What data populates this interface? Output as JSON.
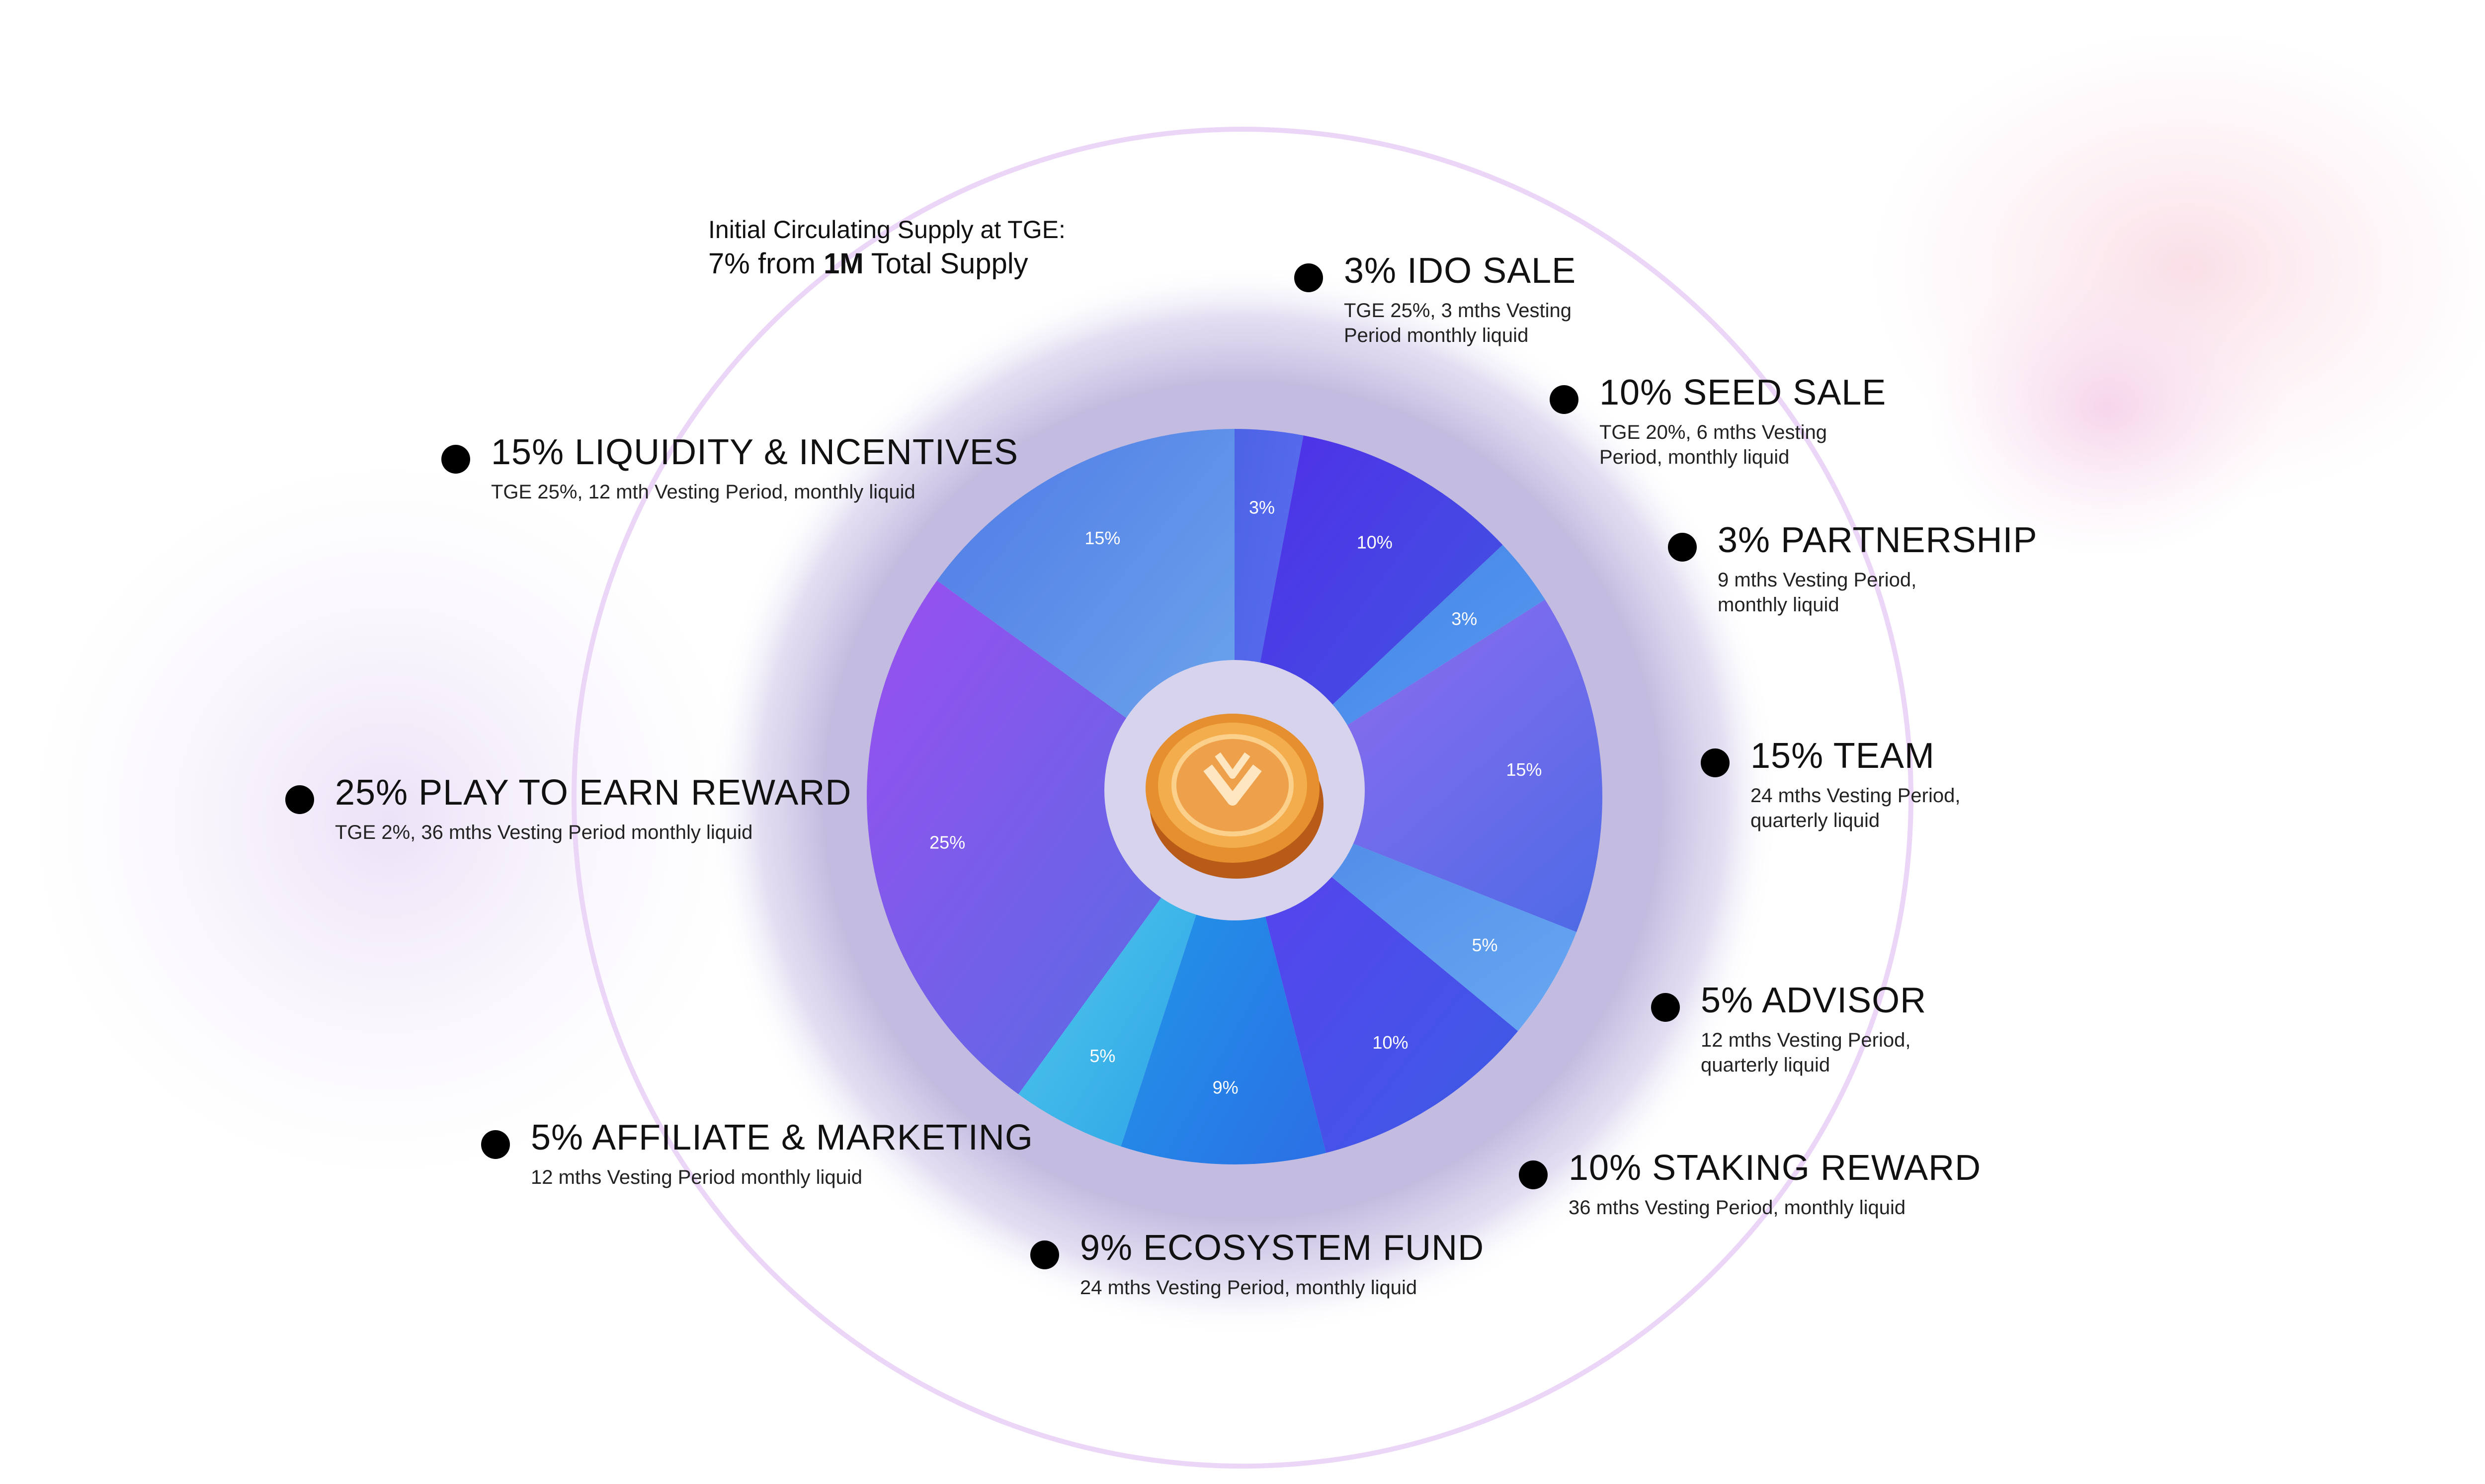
{
  "supply": {
    "line1": "Initial Circulating Supply at TGE:",
    "line2_prefix": "7% from ",
    "line2_bold": "1M",
    "line2_suffix": " Total Supply"
  },
  "colors": {
    "ring_bg": "#c4bce0",
    "center": "#d7d3ec",
    "outer_ring": "#e9d3f6",
    "coin": "#e08a30"
  },
  "chart_data": {
    "type": "pie",
    "title": "",
    "start": "top, clockwise",
    "slices": [
      {
        "label": "3%",
        "value": 3,
        "color_from": "#4d63e6",
        "color_to": "#5b6ff0"
      },
      {
        "label": "10%",
        "value": 10,
        "color_from": "#4f2ee8",
        "color_to": "#3f5ae0"
      },
      {
        "label": "3%",
        "value": 3,
        "color_from": "#3f7fe6",
        "color_to": "#5b9ef0"
      },
      {
        "label": "15%",
        "value": 15,
        "color_from": "#9a6ef0",
        "color_to": "#4d6ae6"
      },
      {
        "label": "5%",
        "value": 5,
        "color_from": "#4b86e6",
        "color_to": "#68a8f2"
      },
      {
        "label": "10%",
        "value": 10,
        "color_from": "#5b3ff0",
        "color_to": "#3b5ce4"
      },
      {
        "label": "9%",
        "value": 9,
        "color_from": "#1f9de8",
        "color_to": "#2b6fe6"
      },
      {
        "label": "5%",
        "value": 5,
        "color_from": "#56d0ec",
        "color_to": "#2a9ee6"
      },
      {
        "label": "25%",
        "value": 25,
        "color_from": "#9a4ff0",
        "color_to": "#4f6fe2"
      },
      {
        "label": "15%",
        "value": 15,
        "color_from": "#4f7ae6",
        "color_to": "#6ea8ec"
      }
    ]
  },
  "legend": [
    {
      "title": "3% IDO SALE",
      "desc": [
        "TGE 25%, 3 mths Vesting",
        "Period monthly liquid"
      ]
    },
    {
      "title": "10% SEED SALE",
      "desc": [
        "TGE 20%, 6 mths Vesting",
        "Period, monthly liquid"
      ]
    },
    {
      "title": "3% PARTNERSHIP",
      "desc": [
        "9 mths Vesting Period,",
        "monthly liquid"
      ]
    },
    {
      "title": "15% TEAM",
      "desc": [
        "24 mths Vesting Period,",
        "quarterly liquid"
      ]
    },
    {
      "title": "5% ADVISOR",
      "desc": [
        "12 mths Vesting Period,",
        "quarterly liquid"
      ]
    },
    {
      "title": "10% STAKING REWARD",
      "desc": [
        "36 mths Vesting Period, monthly liquid"
      ]
    },
    {
      "title": "9% ECOSYSTEM FUND",
      "desc": [
        "24 mths Vesting Period, monthly liquid"
      ]
    },
    {
      "title": "5% AFFILIATE & MARKETING",
      "desc": [
        "12 mths Vesting Period monthly liquid"
      ]
    },
    {
      "title": "25% PLAY TO EARN REWARD",
      "desc": [
        "TGE 2%, 36 mths Vesting Period monthly liquid"
      ]
    },
    {
      "title": "15% LIQUIDITY & INCENTIVES",
      "desc": [
        "TGE 25%, 12 mth Vesting Period, monthly liquid"
      ]
    }
  ]
}
